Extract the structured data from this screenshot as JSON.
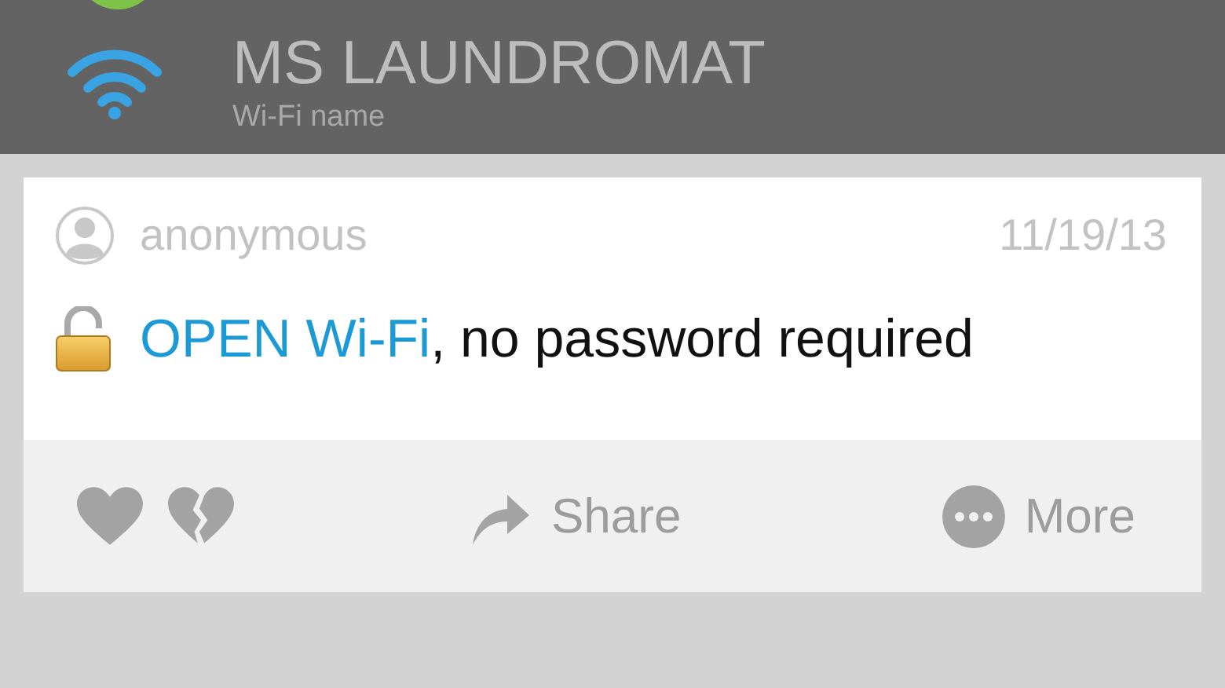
{
  "network": {
    "name": "MS LAUNDROMAT",
    "caption": "Wi-Fi name"
  },
  "post": {
    "author": "anonymous",
    "date": "11/19/13",
    "highlight": "OPEN Wi-Fi",
    "message": ", no password required"
  },
  "actions": [
    {
      "kind": "like"
    },
    {
      "kind": "dislike"
    },
    {
      "kind": "share",
      "label": "Share"
    },
    {
      "kind": "more",
      "label": "More"
    }
  ]
}
